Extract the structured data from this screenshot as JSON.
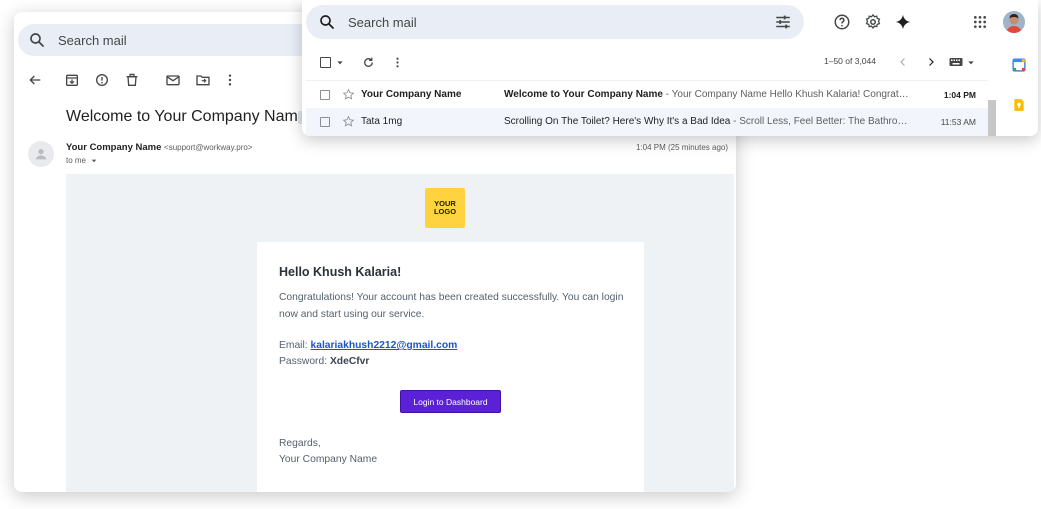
{
  "back_window": {
    "search_placeholder": "Search mail",
    "subject": "Welcome to Your Company Name",
    "sender_name": "Your Company Name",
    "sender_address": "<support@workway.pro>",
    "to_line": "to me",
    "time_sent": "1:04 PM (25 minutes ago)"
  },
  "email": {
    "logo_line1": "YOUR",
    "logo_line2": "LOGO",
    "greeting": "Hello Khush Kalaria!",
    "paragraph": "Congratulations! Your account has been created successfully. You can login now and start using our service.",
    "email_label": "Email: ",
    "email_value": "kalariakhush2212@gmail.com",
    "password_label": "Password: ",
    "password_value": "XdeCfvr",
    "button_label": "Login to Dashboard",
    "regards": "Regards,",
    "signoff": "Your Company Name",
    "colors": {
      "logo_bg": "#ffd23f",
      "button_bg": "#5b21d6",
      "link": "#1a56c4"
    }
  },
  "front_window": {
    "search_placeholder": "Search mail",
    "pager": "1–50 of 3,044",
    "rows": [
      {
        "from": "Your Company Name",
        "subject": "Welcome to Your Company Name",
        "snippet": " - Your Company Name Hello Khush Kalaria! Congrat…",
        "time": "1:04 PM",
        "unread": true
      },
      {
        "from": "Tata 1mg",
        "subject": "Scrolling On The Toilet? Here's Why It's a Bad Idea",
        "snippet": " - Scroll Less, Feel Better: The Bathro…",
        "time": "11:53 AM",
        "unread": false
      }
    ]
  },
  "icons": [
    "search-icon",
    "back-arrow-icon",
    "archive-icon",
    "report-spam-icon",
    "delete-icon",
    "mark-unread-icon",
    "move-to-icon",
    "more-vert-icon",
    "tune-icon",
    "help-icon",
    "settings-icon",
    "gemini-icon",
    "apps-grid-icon",
    "refresh-icon",
    "chevron-left-icon",
    "chevron-right-icon",
    "keyboard-icon",
    "star-icon",
    "calendar-icon",
    "keep-icon"
  ]
}
